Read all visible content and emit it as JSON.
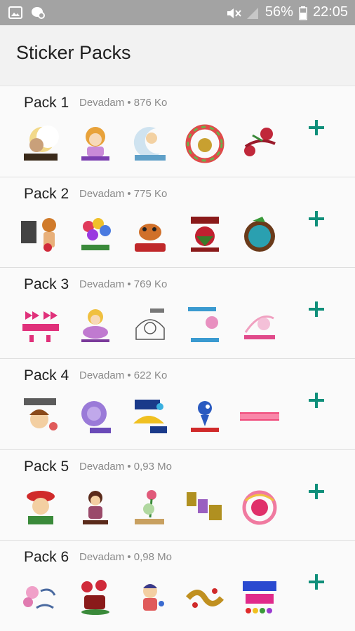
{
  "status_bar": {
    "battery": "56%",
    "time": "22:05",
    "icons": [
      "gallery-icon",
      "chat-bubble-icon",
      "mute-icon",
      "signal-icon",
      "battery-icon"
    ]
  },
  "header": {
    "title": "Sticker Packs"
  },
  "accent_color": "#0f8f7a",
  "packs": [
    {
      "name": "Pack 1",
      "meta": "Devadam • 876 Ko",
      "stickers": [
        "moon-boa-noite",
        "girl-boa-noite",
        "angel-boa-noite",
        "flower-wreath",
        "roses-boa-noite"
      ]
    },
    {
      "name": "Pack 2",
      "meta": "Devadam • 775 Ko",
      "stickers": [
        "girl-bom-dia",
        "bouquet-bom-dia",
        "dog-bom-dia",
        "rose-bom-dia",
        "coconut-bom-dia"
      ]
    },
    {
      "name": "Pack 3",
      "meta": "Devadam • 769 Ko",
      "stickers": [
        "bows-boa-noite",
        "fairy-boa-noite",
        "santa-boa-noite",
        "moon-boa-noite-2",
        "swirl-boa-noite"
      ]
    },
    {
      "name": "Pack 4",
      "meta": "Devadam • 622 Ko",
      "stickers": [
        "boy-bom-dia",
        "purple-rose-bom-dia",
        "umbrella-bom-dia",
        "bird-bom-dia",
        "text-bom-dia"
      ]
    },
    {
      "name": "Pack 5",
      "meta": "Devadam • 0,93 Mo",
      "stickers": [
        "girl-hat-boa-noite",
        "doll-boa-noite",
        "rose-boa-noite",
        "letters-boa-noite",
        "swirl-rose"
      ]
    },
    {
      "name": "Pack 6",
      "meta": "Devadam • 0,98 Mo",
      "stickers": [
        "flowers-bom-dia",
        "roses-cup-bom-dia",
        "girl-bom-dia-2",
        "gold-bom-dia",
        "bom-dia-hearts"
      ]
    }
  ]
}
